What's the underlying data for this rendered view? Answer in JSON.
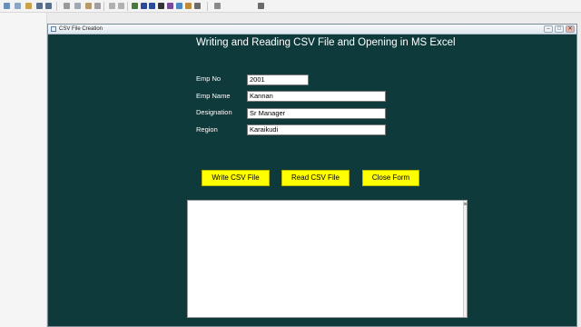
{
  "window": {
    "title": "CSV File Creation",
    "minimize_glyph": "–",
    "maximize_glyph": "□",
    "close_glyph": "✕"
  },
  "form": {
    "heading": "Writing and Reading CSV File  and  Opening in MS Excel",
    "fields": [
      {
        "label": "Emp No",
        "value": "2001"
      },
      {
        "label": "Emp Name",
        "value": "Kannan"
      },
      {
        "label": "Designation",
        "value": "Sr Manager"
      },
      {
        "label": "Region",
        "value": "Karaikudi"
      }
    ],
    "buttons": {
      "write": "Write CSV File",
      "read": "Read CSV File",
      "close": "Close Form"
    },
    "output_text": ""
  },
  "colors": {
    "form_background": "#0e3a3c",
    "button_background": "#ffff00"
  }
}
